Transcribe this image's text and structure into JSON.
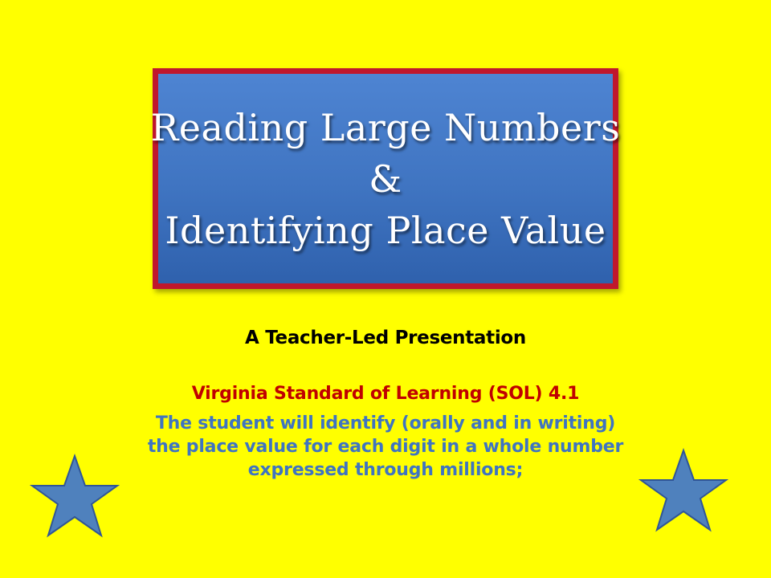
{
  "slide": {
    "title_lines": [
      "Reading Large Numbers",
      "&",
      "Identifying Place Value"
    ],
    "subtitle": "A Teacher-Led Presentation",
    "standard": "Virginia Standard of Learning (SOL) 4.1",
    "description_lines": [
      "The student will identify  (orally and in writing)",
      "the place value for each digit in a whole number",
      "expressed through millions;"
    ]
  },
  "colors": {
    "background": "#ffff00",
    "title_box_fill": "#3f74c1",
    "title_box_border": "#c0172d",
    "standard_text": "#c00000",
    "description_text": "#3f74c1",
    "star_fill": "#4f81bd",
    "star_stroke": "#2f5597"
  },
  "icons": {
    "left_star": "star-icon",
    "right_star": "star-icon"
  }
}
